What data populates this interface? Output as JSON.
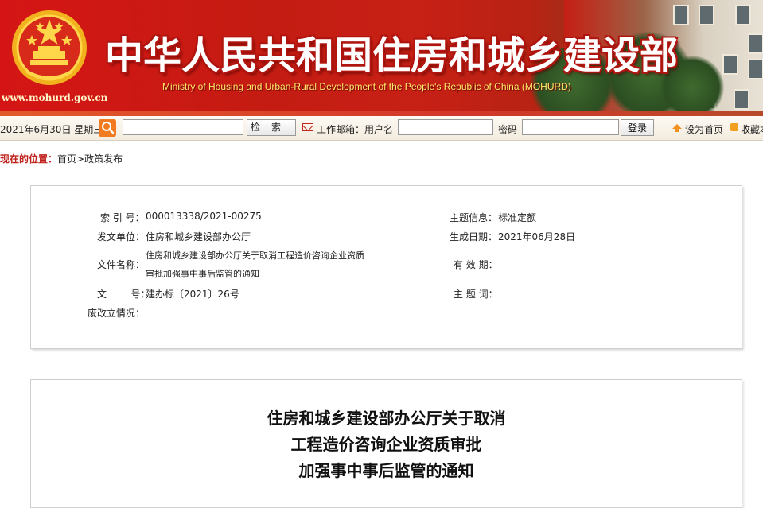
{
  "banner": {
    "site_url": "www.mohurd.gov.cn",
    "title_cn": "中华人民共和国住房和城乡建设部",
    "title_en": "Ministry of Housing and Urban-Rural Development of the People's Republic of China (MOHURD)"
  },
  "toolbar": {
    "date": "2021年6月30日 星期三",
    "search_placeholder": "",
    "search_button": "检索",
    "mail_label": "工作邮箱：用户名",
    "password_label": "密码",
    "login_button": "登录",
    "home_link": "设为首页",
    "favorite_link": "收藏本"
  },
  "breadcrumb": {
    "label": "现在的位置：",
    "path": "首页>政策发布"
  },
  "meta": {
    "index_label": "索 引 号：",
    "index_value": "000013338/2021-00275",
    "issuer_label": "发文单位：",
    "issuer_value": "住房和城乡建设部办公厅",
    "name_label": "文件名称：",
    "name_line1": "住房和城乡建设部办公厅关于取消工程造价咨询企业资质",
    "name_line2": "审批加强事中事后监管的通知",
    "docno_label": "文        号：",
    "docno_value": "建办标〔2021〕26号",
    "status_label": "废改立情况：",
    "topic_label": "主题信息：",
    "topic_value": "标准定额",
    "date_label": "生成日期：",
    "date_value": "2021年06月28日",
    "valid_label": "有 效 期：",
    "keywords_label": "主 题 词："
  },
  "article": {
    "title_line1": "住房和城乡建设部办公厅关于取消",
    "title_line2": "工程造价咨询企业资质审批",
    "title_line3": "加强事中事后监管的通知"
  },
  "colors": {
    "banner_red": "#d51515",
    "title_yellow": "#ffe96a",
    "breadcrumb_red": "#c0201a"
  }
}
